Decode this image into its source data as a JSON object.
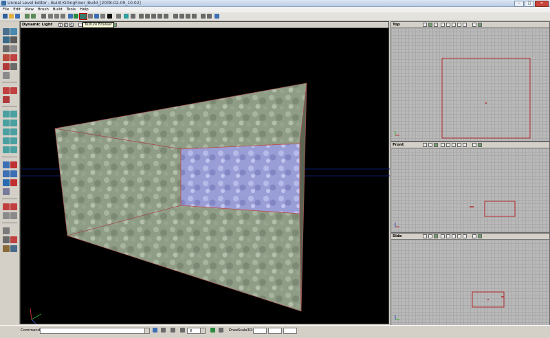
{
  "window": {
    "title": "Unreal Level Editor - Build KillingFloor_Build_[2008-02-09_10.02]",
    "minimize": "–",
    "maximize": "□",
    "close": "✕"
  },
  "menu": [
    "File",
    "Edit",
    "View",
    "Brush",
    "Build",
    "Tools",
    "Help"
  ],
  "toolbar": {
    "highlighted_button": "texture-browser-button",
    "tooltip": "Texture Browser"
  },
  "viewports": {
    "perspective": {
      "label": "Dynamic Light",
      "mode_letters": [
        "T",
        "F",
        "S"
      ]
    },
    "top": {
      "label": "Top",
      "mode_letters": [
        "T",
        "F",
        "S"
      ],
      "active_letter": "T"
    },
    "front": {
      "label": "Front",
      "mode_letters": [
        "T",
        "F",
        "S"
      ],
      "active_letter": "F"
    },
    "side": {
      "label": "Side",
      "mode_letters": [
        "T",
        "F",
        "S"
      ],
      "active_letter": "S"
    }
  },
  "statusbar": {
    "command_label": "Command",
    "command_value": "",
    "grid_value": "8",
    "drawscale_label": "DrawScale3D:",
    "drawscale_values": [
      "",
      "",
      ""
    ]
  },
  "colors": {
    "brush_red": "#b3262a",
    "wall_green": "#8e9e86",
    "back_wall_lavender": "#9b9fd6",
    "viewport_black": "#000000",
    "grid_gray": "#b9b9b9"
  }
}
